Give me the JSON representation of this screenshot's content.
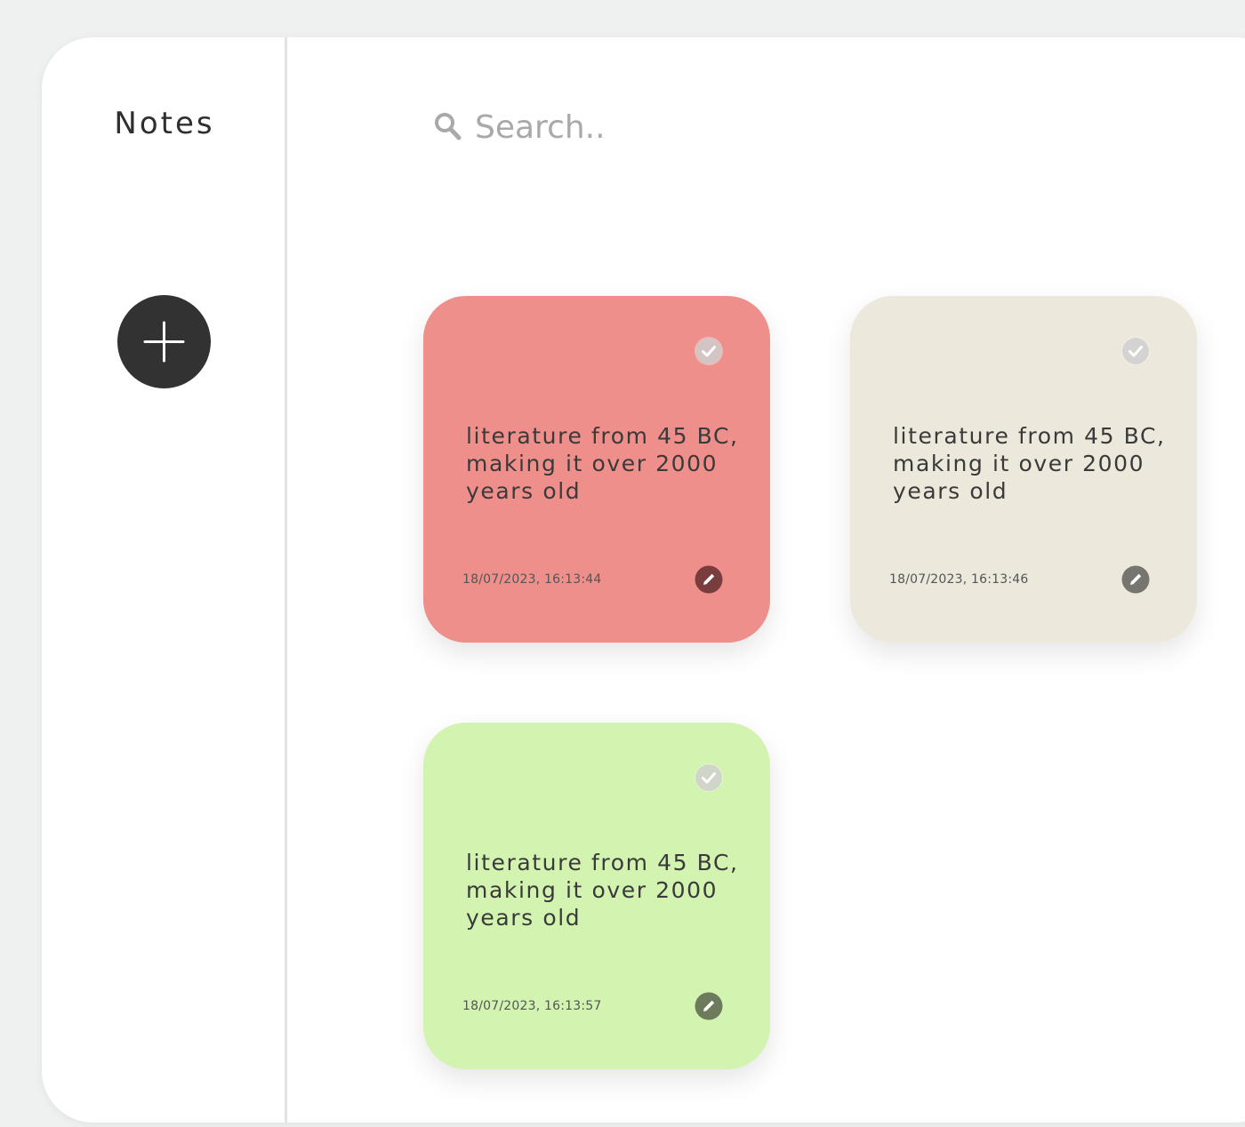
{
  "sidebar": {
    "title": "Notes",
    "add_icon": "plus-icon"
  },
  "search": {
    "placeholder": "Search..",
    "icon": "search-icon"
  },
  "notes": [
    {
      "text": "literature from 45 BC, making it over 2000 years old",
      "date": "18/07/2023, 16:13:44",
      "color": "#ee8f8b",
      "edit_color": "#7a3d3d"
    },
    {
      "text": "literature from 45 BC, making it over 2000 years old",
      "date": "18/07/2023, 16:13:46",
      "color": "#ece8db",
      "edit_color": "#777570"
    },
    {
      "text": "literature from 45 BC, making it over 2000 years old",
      "date": "18/07/2023, 16:13:57",
      "color": "#d3f3b0",
      "edit_color": "#6d7a5c"
    }
  ],
  "colors": {
    "background": "#eff0f0",
    "panel": "#ffffff",
    "add_button": "#323232"
  }
}
